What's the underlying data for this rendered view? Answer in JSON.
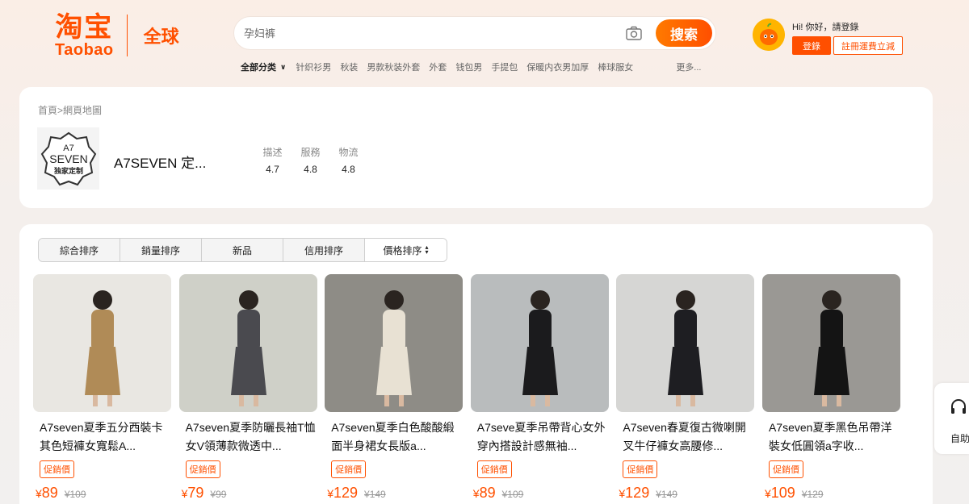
{
  "header": {
    "logo_cn": "淘宝",
    "logo_en": "Taobao",
    "logo_global": "全球",
    "search_placeholder": "孕妇裤",
    "search_button": "搜索",
    "categories_all": "全部分类",
    "categories": [
      "针织衫男",
      "秋装",
      "男款秋装外套",
      "外套",
      "钱包男",
      "手提包",
      "保暖内衣男加厚",
      "棒球服女"
    ],
    "more": "更多...",
    "greeting": "Hi! 你好，請登錄",
    "login": "登錄",
    "register": "註冊運費立減"
  },
  "shop": {
    "breadcrumb": "首頁>網頁地圖",
    "logo_line1": "A7",
    "logo_line2": "SEVEN",
    "logo_line3": "独家定制",
    "name": "A7SEVEN 定...",
    "ratings": [
      {
        "label": "描述",
        "value": "4.7"
      },
      {
        "label": "服務",
        "value": "4.8"
      },
      {
        "label": "物流",
        "value": "4.8"
      }
    ]
  },
  "sort": [
    "綜合排序",
    "銷量排序",
    "新品",
    "信用排序",
    "價格排序"
  ],
  "products": [
    {
      "title": "A7seven夏季五分西裝卡其色短褲女寬鬆A...",
      "badge": "促銷價",
      "price": "89",
      "orig": "¥109",
      "bg": "#e9e7e2",
      "cloth": "#b08b57"
    },
    {
      "title": "A7seven夏季防曬長袖T恤女V領薄款微透中...",
      "badge": "促銷價",
      "price": "79",
      "orig": "¥99",
      "bg": "#cfd0c8",
      "cloth": "#4a4a4f"
    },
    {
      "title": "A7seven夏季白色酸酸緞面半身裙女長版a...",
      "badge": "促銷價",
      "price": "129",
      "orig": "¥149",
      "bg": "#8e8c86",
      "cloth": "#e8e1d3"
    },
    {
      "title": "A7seve夏季吊帶背心女外穿內搭設計感無袖...",
      "badge": "促銷價",
      "price": "89",
      "orig": "¥109",
      "bg": "#b9bcbd",
      "cloth": "#1b1b1d"
    },
    {
      "title": "A7seven春夏復古微喇開叉牛仔褲女高腰修...",
      "badge": "促銷價",
      "price": "129",
      "orig": "¥149",
      "bg": "#d6d6d4",
      "cloth": "#1e1e22"
    },
    {
      "title": "A7seven夏季黑色吊帶洋裝女低圓領a字收...",
      "badge": "促銷價",
      "price": "109",
      "orig": "¥129",
      "bg": "#9a9894",
      "cloth": "#141414"
    }
  ],
  "float_tab": {
    "label": "自助"
  },
  "colors": {
    "accent": "#ff5000",
    "brand": "#ff5000"
  }
}
